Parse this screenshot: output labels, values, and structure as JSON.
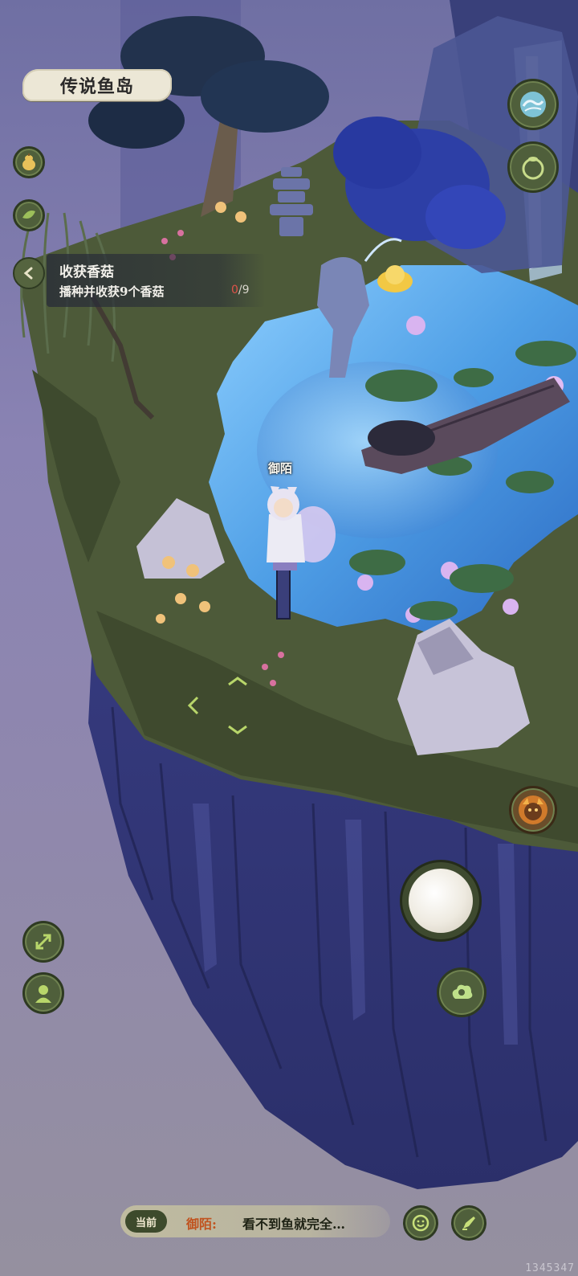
{
  "location": {
    "name": "传说鱼岛"
  },
  "quest": {
    "title": "收获香菇",
    "description": "播种并收获9个香菇",
    "progress_current": "0",
    "progress_total": "/9"
  },
  "player": {
    "name": "御陌"
  },
  "chat": {
    "channel": "当前",
    "speaker": "御陌:",
    "message": "看不到鱼就完全…"
  },
  "build_id": "1345347",
  "icons": {
    "left": [
      "gourd-icon",
      "leaf-icon",
      "back-arrow-icon",
      "expand-icon",
      "character-icon"
    ],
    "right": [
      "wave-icon",
      "bag-icon",
      "monster-portrait-icon",
      "cloud-skill-icon",
      "emoji-icon",
      "chat-edit-icon"
    ]
  },
  "colors": {
    "ui_green": "#4f5f3b",
    "panel_cream": "#ece7d6",
    "progress_red": "#e0534a",
    "speaker_orange": "#c0531f"
  }
}
